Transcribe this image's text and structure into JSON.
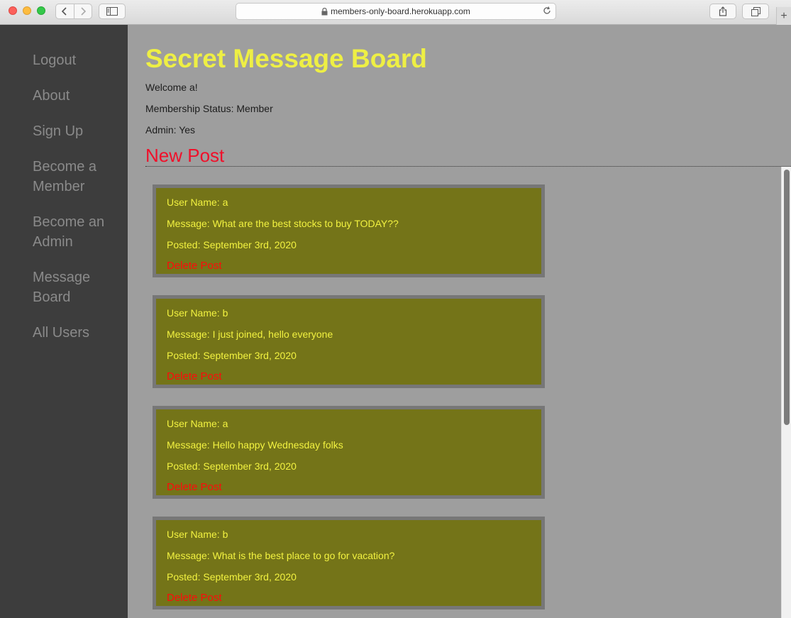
{
  "browser": {
    "url": "members-only-board.herokuapp.com",
    "new_tab": "+"
  },
  "sidebar": {
    "items": [
      {
        "label": "Logout"
      },
      {
        "label": "About"
      },
      {
        "label": "Sign Up"
      },
      {
        "label": "Become a Member"
      },
      {
        "label": "Become an Admin"
      },
      {
        "label": "Message Board"
      },
      {
        "label": "All Users"
      }
    ]
  },
  "main": {
    "title": "Secret Message Board",
    "welcome": "Welcome a!",
    "membership": "Membership Status: Member",
    "admin": "Admin: Yes",
    "new_post": "New Post"
  },
  "posts": [
    {
      "user": "User Name: a",
      "message": "Message: What are the best stocks to buy TODAY??",
      "posted": "Posted: September 3rd, 2020",
      "delete": "Delete Post"
    },
    {
      "user": "User Name: b",
      "message": "Message: I just joined, hello everyone",
      "posted": "Posted: September 3rd, 2020",
      "delete": "Delete Post"
    },
    {
      "user": "User Name: a",
      "message": "Message: Hello happy Wednesday folks",
      "posted": "Posted: September 3rd, 2020",
      "delete": "Delete Post"
    },
    {
      "user": "User Name: b",
      "message": "Message: What is the best place to go for vacation?",
      "posted": "Posted: September 3rd, 2020",
      "delete": "Delete Post"
    }
  ],
  "colors": {
    "title": "#eeef44",
    "accent_red": "#f0102a",
    "post_bg": "#747418",
    "sidebar_bg": "#3d3d3d",
    "page_bg": "#9e9e9e"
  }
}
